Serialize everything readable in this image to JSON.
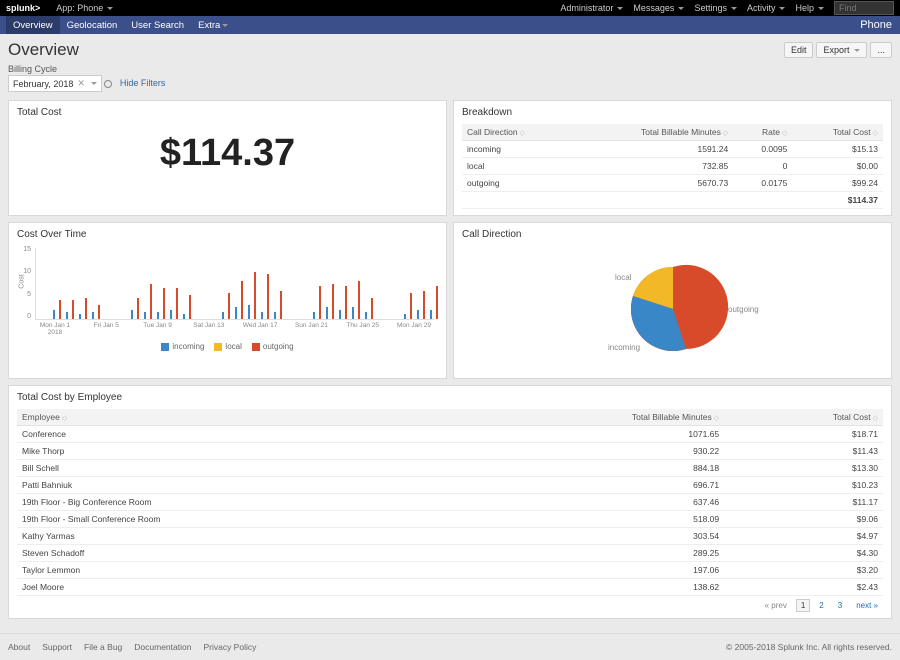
{
  "top": {
    "logo": "splunk>",
    "app_label": "App: Phone",
    "admin": "Administrator",
    "messages": "Messages",
    "settings": "Settings",
    "activity": "Activity",
    "help": "Help",
    "find_placeholder": "Find"
  },
  "nav": {
    "tabs": [
      "Overview",
      "Geolocation",
      "User Search",
      "Extra"
    ],
    "brand": "Phone"
  },
  "page": {
    "title": "Overview",
    "edit": "Edit",
    "export": "Export",
    "more": "...",
    "billing_label": "Billing Cycle",
    "billing_value": "February, 2018",
    "hide_filters": "Hide Filters"
  },
  "total_cost": {
    "title": "Total Cost",
    "value": "$114.37"
  },
  "breakdown": {
    "title": "Breakdown",
    "cols": [
      "Call Direction",
      "Total Billable Minutes",
      "Rate",
      "Total Cost"
    ],
    "rows": [
      {
        "dir": "incoming",
        "min": "1591.24",
        "rate": "0.0095",
        "cost": "$15.13"
      },
      {
        "dir": "local",
        "min": "732.85",
        "rate": "0",
        "cost": "$0.00"
      },
      {
        "dir": "outgoing",
        "min": "5670.73",
        "rate": "0.0175",
        "cost": "$99.24"
      }
    ],
    "total": "$114.37"
  },
  "cost_over_time": {
    "title": "Cost Over Time",
    "ylab": "Cost",
    "yticks": [
      "15",
      "10",
      "5",
      "0"
    ],
    "xticks": [
      "Mon Jan 1 2018",
      "Fri Jan 5",
      "Tue Jan 9",
      "Sat Jan 13",
      "Wed Jan 17",
      "Sun Jan 21",
      "Thu Jan 25",
      "Mon Jan 29"
    ],
    "legend": [
      "incoming",
      "local",
      "outgoing"
    ]
  },
  "call_direction": {
    "title": "Call Direction",
    "labels": {
      "local": "local",
      "incoming": "incoming",
      "outgoing": "outgoing"
    }
  },
  "employee": {
    "title": "Total Cost by Employee",
    "cols": [
      "Employee",
      "Total Billable Minutes",
      "Total Cost"
    ],
    "rows": [
      {
        "e": "Conference",
        "m": "1071.65",
        "c": "$18.71"
      },
      {
        "e": "Mike Thorp",
        "m": "930.22",
        "c": "$11.43"
      },
      {
        "e": "Bill Schell",
        "m": "884.18",
        "c": "$13.30"
      },
      {
        "e": "Patti Bahniuk",
        "m": "696.71",
        "c": "$10.23"
      },
      {
        "e": "19th Floor - Big Conference Room",
        "m": "637.46",
        "c": "$11.17"
      },
      {
        "e": "19th Floor - Small Conference Room",
        "m": "518.09",
        "c": "$9.06"
      },
      {
        "e": "Kathy Yarmas",
        "m": "303.54",
        "c": "$4.97"
      },
      {
        "e": "Steven Schadoff",
        "m": "289.25",
        "c": "$4.30"
      },
      {
        "e": "Taylor Lemmon",
        "m": "197.06",
        "c": "$3.20"
      },
      {
        "e": "Joel Moore",
        "m": "138.62",
        "c": "$2.43"
      }
    ],
    "pager": {
      "prev": "« prev",
      "pages": [
        "1",
        "2",
        "3"
      ],
      "next": "next »"
    }
  },
  "footer": {
    "links": [
      "About",
      "Support",
      "File a Bug",
      "Documentation",
      "Privacy Policy"
    ],
    "copy": "© 2005-2018 Splunk Inc. All rights reserved."
  },
  "chart_data": [
    {
      "type": "bar",
      "title": "Cost Over Time",
      "ylabel": "Cost",
      "ylim": [
        0,
        15
      ],
      "x_tick_labels": [
        "Mon Jan 1 2018",
        "Fri Jan 5",
        "Tue Jan 9",
        "Sat Jan 13",
        "Wed Jan 17",
        "Sun Jan 21",
        "Thu Jan 25",
        "Mon Jan 29"
      ],
      "x": [
        1,
        2,
        3,
        4,
        5,
        6,
        7,
        8,
        9,
        10,
        11,
        12,
        13,
        14,
        15,
        16,
        17,
        18,
        19,
        20,
        21,
        22,
        23,
        24,
        25,
        26,
        27,
        28,
        29,
        30,
        31
      ],
      "series": [
        {
          "name": "incoming",
          "values": [
            0,
            2,
            1.5,
            1,
            1.5,
            0,
            0,
            2,
            1.5,
            1.5,
            2,
            1,
            0,
            0,
            1.5,
            2.5,
            3,
            1.5,
            1.5,
            0,
            0,
            1.5,
            2.5,
            2,
            2.5,
            1.5,
            0,
            0,
            1,
            2,
            2
          ]
        },
        {
          "name": "local",
          "values": [
            0,
            0,
            0,
            0,
            0,
            0,
            0,
            0,
            0,
            0,
            0,
            0,
            0,
            0,
            0,
            0,
            0,
            0,
            0,
            0,
            0,
            0,
            0,
            0,
            0,
            0,
            0,
            0,
            0,
            0,
            0
          ]
        },
        {
          "name": "outgoing",
          "values": [
            0,
            4,
            4,
            4.5,
            3,
            0,
            0,
            4.5,
            7.5,
            6.5,
            6.5,
            5,
            0,
            0,
            5.5,
            8,
            10,
            9.5,
            6,
            0,
            0,
            7,
            7.5,
            7,
            8,
            4.5,
            0,
            0,
            5.5,
            6,
            7
          ]
        }
      ]
    },
    {
      "type": "pie",
      "title": "Call Direction",
      "series": [
        {
          "name": "Call Direction",
          "slices": [
            {
              "label": "local",
              "value": 10,
              "color": "#f2b827"
            },
            {
              "label": "outgoing",
              "value": 70,
              "color": "#d84b2a"
            },
            {
              "label": "incoming",
              "value": 20,
              "color": "#3a87c8"
            }
          ]
        }
      ]
    }
  ]
}
